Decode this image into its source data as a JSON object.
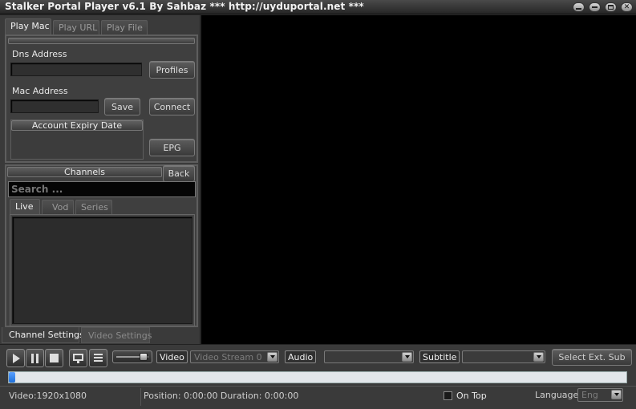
{
  "window": {
    "title": "Stalker Portal Player v6.1 By Sahbaz  *** http://uyduportal.net ***"
  },
  "top_tabs": [
    {
      "label": "Play Mac",
      "active": true
    },
    {
      "label": "Play URL",
      "active": false
    },
    {
      "label": "Play File",
      "active": false
    }
  ],
  "form": {
    "dns_label": "Dns Address",
    "dns_value": "",
    "profiles_label": "Profiles",
    "mac_label": "Mac Address",
    "mac_value": "",
    "save_label": "Save",
    "connect_label": "Connect",
    "expiry_title": "Account Expiry Date",
    "expiry_value": "",
    "epg_label": "EPG"
  },
  "channels": {
    "title": "Channels",
    "back_label": "Back",
    "search_placeholder": "Search ...",
    "tabs": [
      {
        "label": "Live",
        "active": true
      },
      {
        "label": "Vod",
        "active": false
      },
      {
        "label": "Series",
        "active": false
      }
    ]
  },
  "settings_tabs": [
    {
      "label": "Channel Settings",
      "active": true
    },
    {
      "label": "Video Settings",
      "active": false
    }
  ],
  "controls": {
    "play_icon": "play-icon",
    "pause_icon": "pause-icon",
    "stop_icon": "stop-icon",
    "monitor_icon": "monitor-icon",
    "playlist_icon": "playlist-icon",
    "video_label": "Video",
    "video_stream": "Video Stream 0",
    "audio_label": "Audio",
    "audio_stream": "",
    "subtitle_label": "Subtitle",
    "subtitle_stream": "",
    "select_sub_label": "Select Ext. Sub",
    "volume": 0.85,
    "seek_progress": 0.0
  },
  "status": {
    "video_info": "Video:1920x1080",
    "position_info": "Position: 0:00:00 Duration: 0:00:00",
    "on_top_label": "On Top",
    "on_top_checked": false,
    "language_label": "Language",
    "language_value": "Eng"
  },
  "colors": {
    "accent": "#1e6fd9",
    "video_bg": "#000000",
    "panel_bg": "#3a3a3a"
  }
}
